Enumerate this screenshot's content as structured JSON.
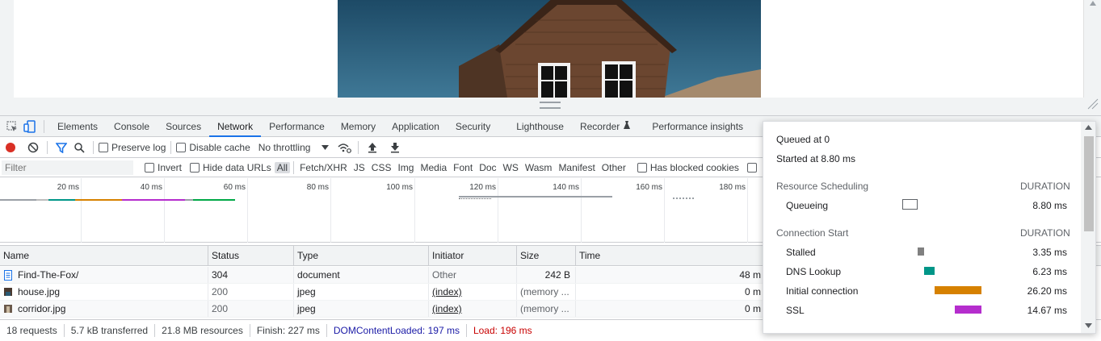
{
  "main_tabs": [
    "Elements",
    "Console",
    "Sources",
    "Network",
    "Performance",
    "Memory",
    "Application",
    "Security",
    "Lighthouse",
    "Recorder",
    "Performance insights"
  ],
  "network_toolbar": {
    "preserve_log": "Preserve log",
    "disable_cache": "Disable cache",
    "throttling": "No throttling"
  },
  "filter_bar": {
    "placeholder": "Filter",
    "invert": "Invert",
    "hide_data_urls": "Hide data URLs",
    "types": [
      "All",
      "Fetch/XHR",
      "JS",
      "CSS",
      "Img",
      "Media",
      "Font",
      "Doc",
      "WS",
      "Wasm",
      "Manifest",
      "Other"
    ],
    "blocked_cookies": "Has blocked cookies"
  },
  "overview_ticks": [
    "20 ms",
    "40 ms",
    "60 ms",
    "80 ms",
    "100 ms",
    "120 ms",
    "140 ms",
    "160 ms",
    "180 ms"
  ],
  "table": {
    "columns": [
      "Name",
      "Status",
      "Type",
      "Initiator",
      "Size",
      "Time"
    ],
    "rows": [
      {
        "name": "Find-The-Fox/",
        "status": "304",
        "type": "document",
        "initiator": "Other",
        "size": "242 B",
        "time": "48 m"
      },
      {
        "name": "house.jpg",
        "status": "200",
        "type": "jpeg",
        "initiator": "(index)",
        "size": "(memory ...",
        "time": "0 m"
      },
      {
        "name": "corridor.jpg",
        "status": "200",
        "type": "jpeg",
        "initiator": "(index)",
        "size": "(memory ...",
        "time": "0 m"
      }
    ]
  },
  "status_bar": {
    "requests": "18 requests",
    "transferred": "5.7 kB transferred",
    "resources": "21.8 MB resources",
    "finish": "Finish: 227 ms",
    "dom_content_loaded": "DOMContentLoaded: 197 ms",
    "load": "Load: 196 ms",
    "dcl_color": "#1a1aa6",
    "load_color": "#c80000"
  },
  "timing": {
    "queued_at": "Queued at 0",
    "started_at": "Started at 8.80 ms",
    "sections": [
      {
        "title": "Resource Scheduling",
        "duration_label": "DURATION",
        "items": [
          {
            "label": "Queueing",
            "value": "8.80 ms",
            "color": "#ffffff"
          }
        ]
      },
      {
        "title": "Connection Start",
        "duration_label": "DURATION",
        "items": [
          {
            "label": "Stalled",
            "value": "3.35 ms",
            "color": "#808080"
          },
          {
            "label": "DNS Lookup",
            "value": "6.23 ms",
            "color": "#009688"
          },
          {
            "label": "Initial connection",
            "value": "26.20 ms",
            "color": "#d68100"
          },
          {
            "label": "SSL",
            "value": "14.67 ms",
            "color": "#b52dcd"
          }
        ]
      }
    ]
  },
  "colors": {
    "accent": "#1a73e8",
    "record": "#d93025"
  }
}
